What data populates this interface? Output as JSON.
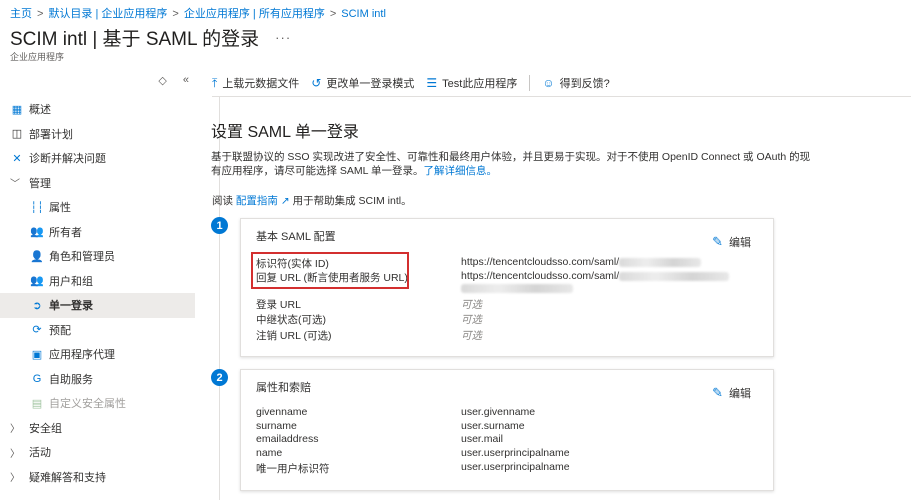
{
  "breadcrumb": {
    "items": [
      "主页",
      "默认目录 | 企业应用程序",
      "企业应用程序 | 所有应用程序",
      "SCIM intl"
    ]
  },
  "page": {
    "title": "SCIM intl | 基于 SAML 的登录",
    "more": "···",
    "subtitle": "企业应用程序"
  },
  "sidebar": {
    "tool_updown": "◇",
    "tool_collapse": "«",
    "items": [
      {
        "label": "概述",
        "icon": "grid-icon"
      },
      {
        "label": "部署计划",
        "icon": "book-icon"
      },
      {
        "label": "诊断并解决问题",
        "icon": "wrench-icon"
      },
      {
        "label": "管理",
        "icon": "chevron-down-icon"
      },
      {
        "label": "属性",
        "icon": "bars-icon"
      },
      {
        "label": "所有者",
        "icon": "users-icon"
      },
      {
        "label": "角色和管理员",
        "icon": "user-role-icon"
      },
      {
        "label": "用户和组",
        "icon": "users-icon"
      },
      {
        "label": "单一登录",
        "icon": "sso-icon"
      },
      {
        "label": "预配",
        "icon": "provision-icon"
      },
      {
        "label": "应用程序代理",
        "icon": "proxy-icon"
      },
      {
        "label": "自助服务",
        "icon": "selfservice-icon"
      },
      {
        "label": "自定义安全属性",
        "icon": "security-attr-icon"
      },
      {
        "label": "安全组",
        "icon": "chevron-right-icon"
      },
      {
        "label": "活动",
        "icon": "chevron-right-icon"
      },
      {
        "label": "疑难解答和支持",
        "icon": "chevron-right-icon"
      }
    ]
  },
  "toolbar": {
    "upload": "上载元数据文件",
    "change_mode": "更改单一登录模式",
    "test": "Test此应用程序",
    "feedback": "得到反馈?"
  },
  "main": {
    "heading": "设置 SAML 单一登录",
    "intro": "基于联盟协议的 SSO 实现改进了安全性、可靠性和最终用户体验，并且更易于实现。对于不使用 OpenID Connect 或 OAuth 的现有应用程序，请尽可能选择 SAML 单一登录。",
    "learn_more": "了解详细信息。",
    "read_prefix": "阅读",
    "guide_link": "配置指南",
    "read_suffix": "用于帮助集成 SCIM intl。"
  },
  "cards": [
    {
      "step": "1",
      "title": "基本 SAML 配置",
      "edit": "编辑",
      "rows": [
        {
          "key": "标识符(实体 ID)",
          "value": "https://tencentcloudsso.com/saml/"
        },
        {
          "key": "回复 URL (断言使用者服务 URL)",
          "value": "https://tencentcloudsso.com/saml/"
        },
        {
          "key": "登录 URL",
          "value": "可选"
        },
        {
          "key": "中继状态(可选)",
          "value": "可选"
        },
        {
          "key": "注销 URL (可选)",
          "value": "可选"
        }
      ]
    },
    {
      "step": "2",
      "title": "属性和索赔",
      "edit": "编辑",
      "rows": [
        {
          "key": "givenname",
          "value": "user.givenname"
        },
        {
          "key": "surname",
          "value": "user.surname"
        },
        {
          "key": "emailaddress",
          "value": "user.mail"
        },
        {
          "key": "name",
          "value": "user.userprincipalname"
        },
        {
          "key": "唯一用户标识符",
          "value": "user.userprincipalname"
        }
      ]
    }
  ],
  "colors": {
    "accent": "#0078d4",
    "highlight": "#d32f2f",
    "active_bg": "#edebe9"
  }
}
